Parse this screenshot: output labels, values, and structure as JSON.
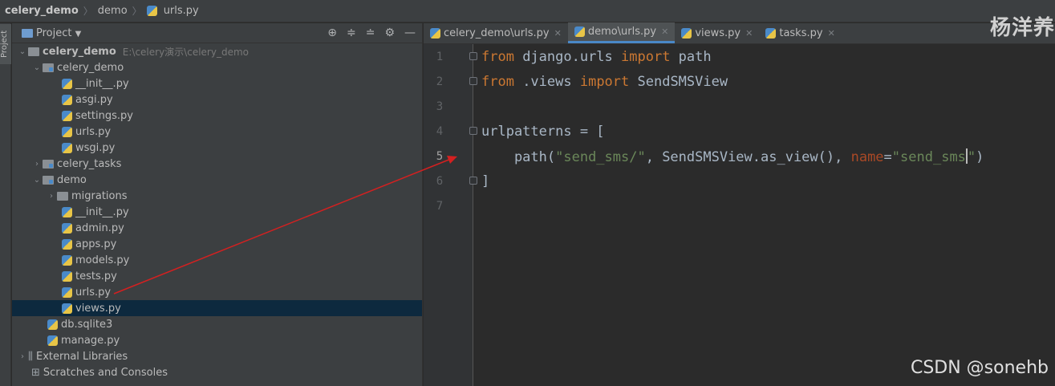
{
  "breadcrumb": {
    "project": "celery_demo",
    "folder": "demo",
    "file": "urls.py"
  },
  "sidebar": {
    "vertical_tab": "Project",
    "header_label": "Project",
    "tree": [
      {
        "label": "celery_demo",
        "path": "E:\\celery演示\\celery_demo"
      },
      {
        "label": "celery_demo"
      },
      {
        "label": "__init__.py"
      },
      {
        "label": "asgi.py"
      },
      {
        "label": "settings.py"
      },
      {
        "label": "urls.py"
      },
      {
        "label": "wsgi.py"
      },
      {
        "label": "celery_tasks"
      },
      {
        "label": "demo"
      },
      {
        "label": "migrations"
      },
      {
        "label": "__init__.py"
      },
      {
        "label": "admin.py"
      },
      {
        "label": "apps.py"
      },
      {
        "label": "models.py"
      },
      {
        "label": "tests.py"
      },
      {
        "label": "urls.py"
      },
      {
        "label": "views.py"
      },
      {
        "label": "db.sqlite3"
      },
      {
        "label": "manage.py"
      },
      {
        "label": "External Libraries"
      },
      {
        "label": "Scratches and Consoles"
      }
    ]
  },
  "tabs": [
    {
      "label": "celery_demo\\urls.py"
    },
    {
      "label": "demo\\urls.py"
    },
    {
      "label": "views.py"
    },
    {
      "label": "tasks.py"
    }
  ],
  "code": {
    "line_numbers": [
      "1",
      "2",
      "3",
      "4",
      "5",
      "6",
      "7"
    ],
    "l1": {
      "k1": "from",
      "t1": " django.urls ",
      "k2": "import",
      "t2": " path"
    },
    "l2": {
      "k1": "from",
      "t1": " .views ",
      "k2": "import",
      "t2": " SendSMSView"
    },
    "l4": {
      "t1": "urlpatterns = ["
    },
    "l5": {
      "t1": "    path(",
      "s1": "\"send_sms/\"",
      "t2": ", SendSMSView.as_view(), ",
      "p1": "name",
      "t3": "=",
      "s2": "\"send_sms",
      "s3": "\"",
      "t4": ")"
    },
    "l6": {
      "t1": "]"
    }
  },
  "watermark_title": "杨洋养",
  "watermark_csdn": "CSDN @sonehb",
  "colors": {
    "keyword": "#cc7832",
    "string": "#6a8759",
    "param": "#aa4926",
    "arrow": "#d42020",
    "selection": "#0d293e"
  }
}
